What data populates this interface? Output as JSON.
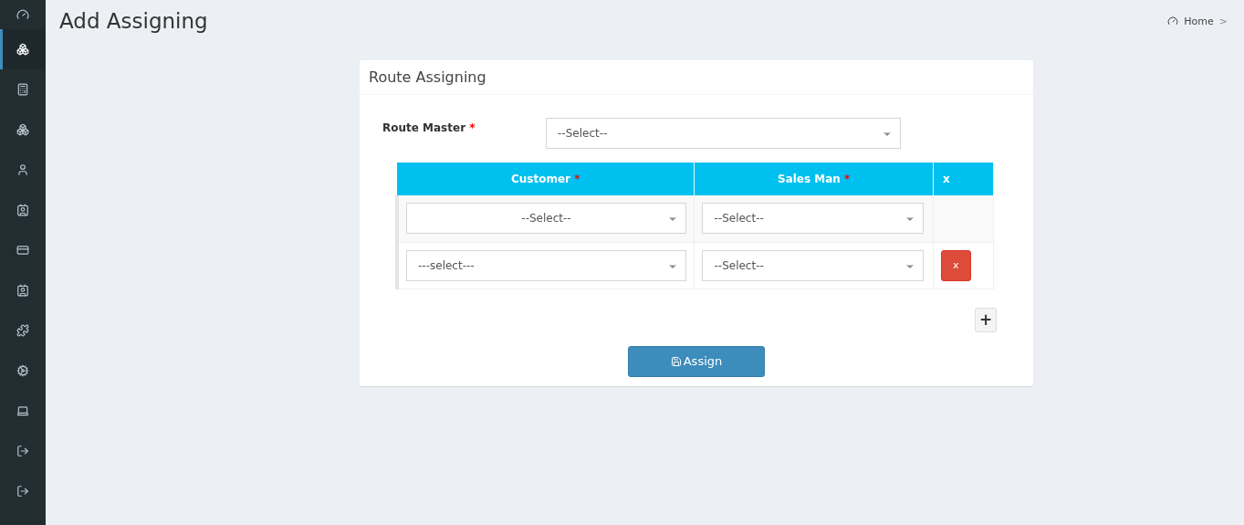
{
  "sidebar": {
    "items": [
      {
        "selected": false
      },
      {
        "selected": true
      },
      {
        "selected": false
      },
      {
        "selected": false
      },
      {
        "selected": false
      },
      {
        "selected": false
      },
      {
        "selected": false
      },
      {
        "selected": false
      },
      {
        "selected": false
      },
      {
        "selected": false
      },
      {
        "selected": false
      },
      {
        "selected": false
      },
      {
        "selected": false
      }
    ]
  },
  "page": {
    "title": "Add Assigning",
    "breadcrumb": {
      "label": "Home",
      "separator": ">"
    }
  },
  "card": {
    "title": "Route Assigning",
    "route_master": {
      "label": "Route Master",
      "required_mark": "*",
      "value": "--Select--"
    },
    "table": {
      "columns": [
        {
          "label": "Customer",
          "required_mark": "*"
        },
        {
          "label": "Sales Man",
          "required_mark": "*"
        },
        {
          "label": "x"
        }
      ],
      "rows": [
        {
          "customer": "--Select--",
          "customer_centered": true,
          "salesman": "--Select--",
          "removable": false
        },
        {
          "customer": "---select---",
          "customer_centered": false,
          "salesman": "--Select--",
          "removable": true,
          "remove_label": "x"
        }
      ]
    },
    "add_label": "+",
    "submit": "Assign"
  }
}
